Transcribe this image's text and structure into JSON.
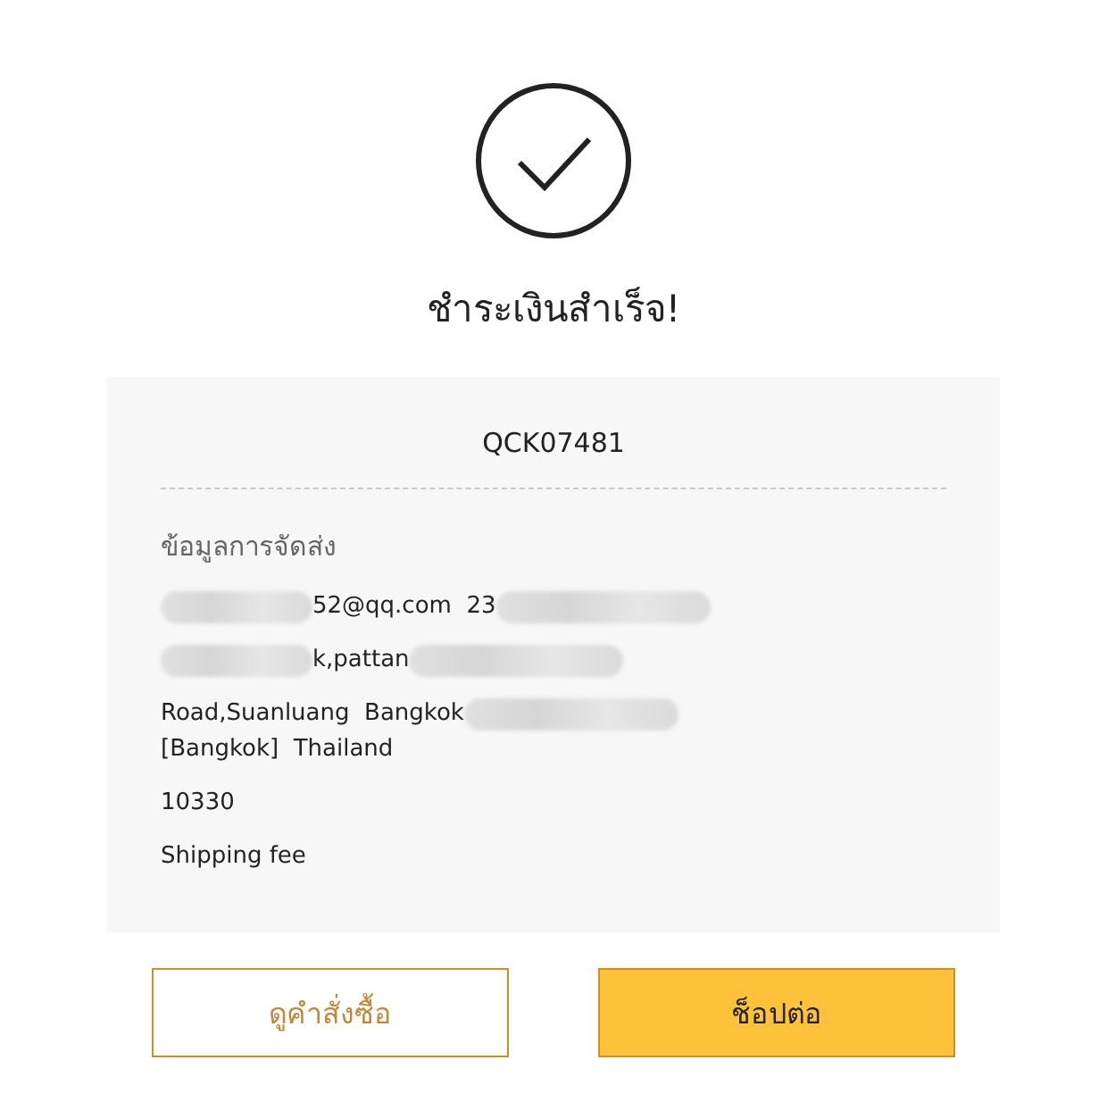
{
  "title": "ชำระเงินสำเร็จ!",
  "order_number": "QCK07481",
  "shipping": {
    "heading": "ข้อมูลการจัดส่ง",
    "blocks": [
      [
        [
          {
            "kind": "redacted"
          },
          {
            "kind": "text",
            "text": "52@qq.com  23"
          },
          {
            "kind": "redacted"
          }
        ]
      ],
      [
        [
          {
            "kind": "redacted"
          },
          {
            "kind": "text",
            "text": "k,pattan"
          },
          {
            "kind": "redacted"
          }
        ]
      ],
      [
        [
          {
            "kind": "text",
            "text": "Road,Suanluang  Bangkok"
          },
          {
            "kind": "redacted"
          }
        ],
        [
          {
            "kind": "text",
            "text": "[Bangkok]  Thailand"
          }
        ]
      ],
      [
        [
          {
            "kind": "text",
            "text": "10330"
          }
        ]
      ],
      [
        [
          {
            "kind": "text",
            "text": "Shipping fee"
          }
        ]
      ]
    ]
  },
  "buttons": [
    {
      "kind": "secondary",
      "label": "ดูคำสั่งซื้อ"
    },
    {
      "kind": "primary",
      "label": "ช็อปต่อ"
    }
  ]
}
